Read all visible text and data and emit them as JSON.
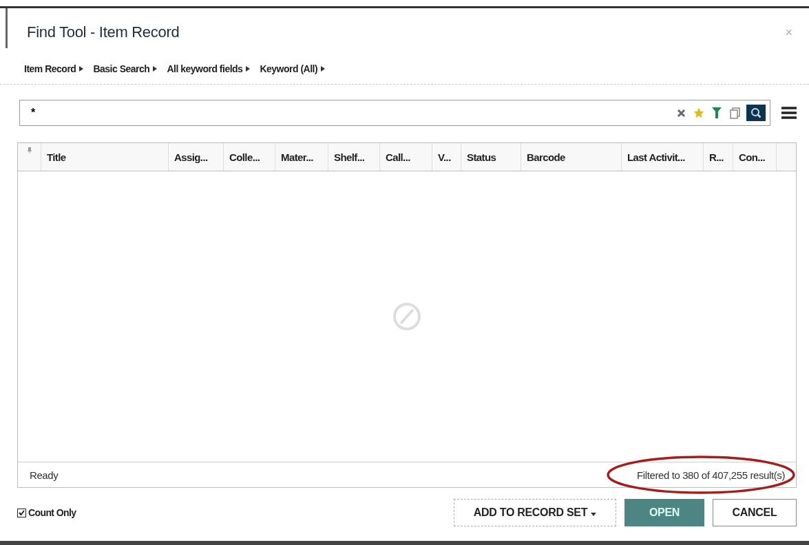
{
  "window": {
    "title": "Find Tool - Item Record",
    "close": "×"
  },
  "breadcrumb": [
    "Item Record",
    "Basic Search",
    "All keyword fields",
    "Keyword (All)"
  ],
  "search": {
    "value": "*"
  },
  "table": {
    "columns": [
      "Title",
      "Assig...",
      "Colle...",
      "Mater...",
      "Shelf...",
      "Call...",
      "V...",
      "Status",
      "Barcode",
      "Last Activit...",
      "R...",
      "Con..."
    ]
  },
  "status_bar": {
    "left": "Ready",
    "right": "Filtered to 380 of 407,255 result(s)",
    "highlighted": true
  },
  "count_only": {
    "label": "Count Only",
    "checked": true
  },
  "buttons": [
    {
      "label": "ADD TO RECORD SET",
      "kind": "dropdown"
    },
    {
      "label": "OPEN",
      "kind": "primary"
    },
    {
      "label": "CANCEL",
      "kind": "plain"
    }
  ]
}
